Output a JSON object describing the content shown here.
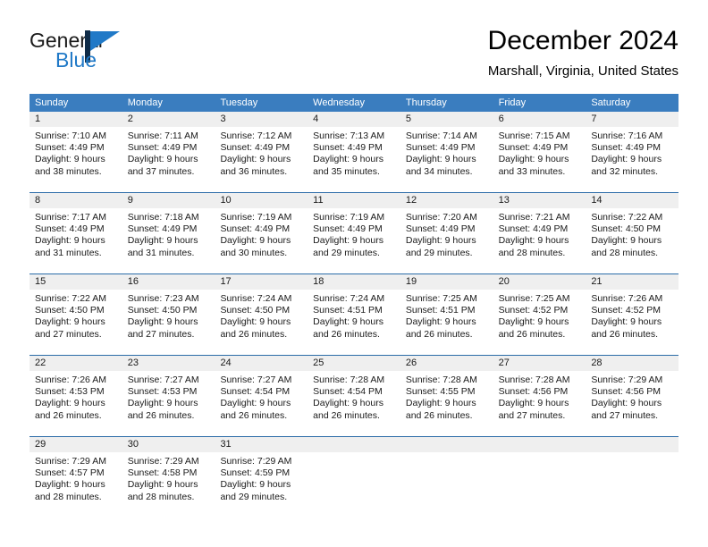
{
  "brand": {
    "word_one": "General",
    "word_two": "Blue",
    "mark": "triangle-flag-logo"
  },
  "header": {
    "month_title": "December 2024",
    "location": "Marshall, Virginia, United States"
  },
  "calendar": {
    "weekday_headers": [
      "Sunday",
      "Monday",
      "Tuesday",
      "Wednesday",
      "Thursday",
      "Friday",
      "Saturday"
    ],
    "colors": {
      "header_blue": "#3a7dbf",
      "week_rule_blue": "#2b6ca8",
      "date_band_gray": "#efefef",
      "brand_blue": "#2079c7",
      "brand_navy": "#0f2b47"
    },
    "weeks": [
      [
        {
          "day": "1",
          "sunrise": "Sunrise: 7:10 AM",
          "sunset": "Sunset: 4:49 PM",
          "daylight_line1": "Daylight: 9 hours",
          "daylight_line2": "and 38 minutes."
        },
        {
          "day": "2",
          "sunrise": "Sunrise: 7:11 AM",
          "sunset": "Sunset: 4:49 PM",
          "daylight_line1": "Daylight: 9 hours",
          "daylight_line2": "and 37 minutes."
        },
        {
          "day": "3",
          "sunrise": "Sunrise: 7:12 AM",
          "sunset": "Sunset: 4:49 PM",
          "daylight_line1": "Daylight: 9 hours",
          "daylight_line2": "and 36 minutes."
        },
        {
          "day": "4",
          "sunrise": "Sunrise: 7:13 AM",
          "sunset": "Sunset: 4:49 PM",
          "daylight_line1": "Daylight: 9 hours",
          "daylight_line2": "and 35 minutes."
        },
        {
          "day": "5",
          "sunrise": "Sunrise: 7:14 AM",
          "sunset": "Sunset: 4:49 PM",
          "daylight_line1": "Daylight: 9 hours",
          "daylight_line2": "and 34 minutes."
        },
        {
          "day": "6",
          "sunrise": "Sunrise: 7:15 AM",
          "sunset": "Sunset: 4:49 PM",
          "daylight_line1": "Daylight: 9 hours",
          "daylight_line2": "and 33 minutes."
        },
        {
          "day": "7",
          "sunrise": "Sunrise: 7:16 AM",
          "sunset": "Sunset: 4:49 PM",
          "daylight_line1": "Daylight: 9 hours",
          "daylight_line2": "and 32 minutes."
        }
      ],
      [
        {
          "day": "8",
          "sunrise": "Sunrise: 7:17 AM",
          "sunset": "Sunset: 4:49 PM",
          "daylight_line1": "Daylight: 9 hours",
          "daylight_line2": "and 31 minutes."
        },
        {
          "day": "9",
          "sunrise": "Sunrise: 7:18 AM",
          "sunset": "Sunset: 4:49 PM",
          "daylight_line1": "Daylight: 9 hours",
          "daylight_line2": "and 31 minutes."
        },
        {
          "day": "10",
          "sunrise": "Sunrise: 7:19 AM",
          "sunset": "Sunset: 4:49 PM",
          "daylight_line1": "Daylight: 9 hours",
          "daylight_line2": "and 30 minutes."
        },
        {
          "day": "11",
          "sunrise": "Sunrise: 7:19 AM",
          "sunset": "Sunset: 4:49 PM",
          "daylight_line1": "Daylight: 9 hours",
          "daylight_line2": "and 29 minutes."
        },
        {
          "day": "12",
          "sunrise": "Sunrise: 7:20 AM",
          "sunset": "Sunset: 4:49 PM",
          "daylight_line1": "Daylight: 9 hours",
          "daylight_line2": "and 29 minutes."
        },
        {
          "day": "13",
          "sunrise": "Sunrise: 7:21 AM",
          "sunset": "Sunset: 4:49 PM",
          "daylight_line1": "Daylight: 9 hours",
          "daylight_line2": "and 28 minutes."
        },
        {
          "day": "14",
          "sunrise": "Sunrise: 7:22 AM",
          "sunset": "Sunset: 4:50 PM",
          "daylight_line1": "Daylight: 9 hours",
          "daylight_line2": "and 28 minutes."
        }
      ],
      [
        {
          "day": "15",
          "sunrise": "Sunrise: 7:22 AM",
          "sunset": "Sunset: 4:50 PM",
          "daylight_line1": "Daylight: 9 hours",
          "daylight_line2": "and 27 minutes."
        },
        {
          "day": "16",
          "sunrise": "Sunrise: 7:23 AM",
          "sunset": "Sunset: 4:50 PM",
          "daylight_line1": "Daylight: 9 hours",
          "daylight_line2": "and 27 minutes."
        },
        {
          "day": "17",
          "sunrise": "Sunrise: 7:24 AM",
          "sunset": "Sunset: 4:50 PM",
          "daylight_line1": "Daylight: 9 hours",
          "daylight_line2": "and 26 minutes."
        },
        {
          "day": "18",
          "sunrise": "Sunrise: 7:24 AM",
          "sunset": "Sunset: 4:51 PM",
          "daylight_line1": "Daylight: 9 hours",
          "daylight_line2": "and 26 minutes."
        },
        {
          "day": "19",
          "sunrise": "Sunrise: 7:25 AM",
          "sunset": "Sunset: 4:51 PM",
          "daylight_line1": "Daylight: 9 hours",
          "daylight_line2": "and 26 minutes."
        },
        {
          "day": "20",
          "sunrise": "Sunrise: 7:25 AM",
          "sunset": "Sunset: 4:52 PM",
          "daylight_line1": "Daylight: 9 hours",
          "daylight_line2": "and 26 minutes."
        },
        {
          "day": "21",
          "sunrise": "Sunrise: 7:26 AM",
          "sunset": "Sunset: 4:52 PM",
          "daylight_line1": "Daylight: 9 hours",
          "daylight_line2": "and 26 minutes."
        }
      ],
      [
        {
          "day": "22",
          "sunrise": "Sunrise: 7:26 AM",
          "sunset": "Sunset: 4:53 PM",
          "daylight_line1": "Daylight: 9 hours",
          "daylight_line2": "and 26 minutes."
        },
        {
          "day": "23",
          "sunrise": "Sunrise: 7:27 AM",
          "sunset": "Sunset: 4:53 PM",
          "daylight_line1": "Daylight: 9 hours",
          "daylight_line2": "and 26 minutes."
        },
        {
          "day": "24",
          "sunrise": "Sunrise: 7:27 AM",
          "sunset": "Sunset: 4:54 PM",
          "daylight_line1": "Daylight: 9 hours",
          "daylight_line2": "and 26 minutes."
        },
        {
          "day": "25",
          "sunrise": "Sunrise: 7:28 AM",
          "sunset": "Sunset: 4:54 PM",
          "daylight_line1": "Daylight: 9 hours",
          "daylight_line2": "and 26 minutes."
        },
        {
          "day": "26",
          "sunrise": "Sunrise: 7:28 AM",
          "sunset": "Sunset: 4:55 PM",
          "daylight_line1": "Daylight: 9 hours",
          "daylight_line2": "and 26 minutes."
        },
        {
          "day": "27",
          "sunrise": "Sunrise: 7:28 AM",
          "sunset": "Sunset: 4:56 PM",
          "daylight_line1": "Daylight: 9 hours",
          "daylight_line2": "and 27 minutes."
        },
        {
          "day": "28",
          "sunrise": "Sunrise: 7:29 AM",
          "sunset": "Sunset: 4:56 PM",
          "daylight_line1": "Daylight: 9 hours",
          "daylight_line2": "and 27 minutes."
        }
      ],
      [
        {
          "day": "29",
          "sunrise": "Sunrise: 7:29 AM",
          "sunset": "Sunset: 4:57 PM",
          "daylight_line1": "Daylight: 9 hours",
          "daylight_line2": "and 28 minutes."
        },
        {
          "day": "30",
          "sunrise": "Sunrise: 7:29 AM",
          "sunset": "Sunset: 4:58 PM",
          "daylight_line1": "Daylight: 9 hours",
          "daylight_line2": "and 28 minutes."
        },
        {
          "day": "31",
          "sunrise": "Sunrise: 7:29 AM",
          "sunset": "Sunset: 4:59 PM",
          "daylight_line1": "Daylight: 9 hours",
          "daylight_line2": "and 29 minutes."
        },
        {
          "day": "",
          "sunrise": "",
          "sunset": "",
          "daylight_line1": "",
          "daylight_line2": ""
        },
        {
          "day": "",
          "sunrise": "",
          "sunset": "",
          "daylight_line1": "",
          "daylight_line2": ""
        },
        {
          "day": "",
          "sunrise": "",
          "sunset": "",
          "daylight_line1": "",
          "daylight_line2": ""
        },
        {
          "day": "",
          "sunrise": "",
          "sunset": "",
          "daylight_line1": "",
          "daylight_line2": ""
        }
      ]
    ]
  }
}
